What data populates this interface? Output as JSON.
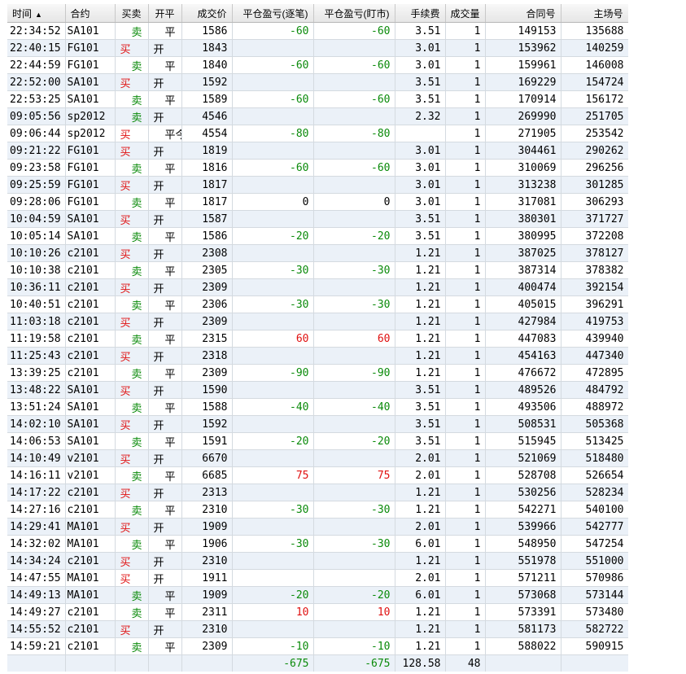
{
  "columns": [
    {
      "label": "时间",
      "sort": "▲"
    },
    {
      "label": "合约"
    },
    {
      "label": "买卖"
    },
    {
      "label": "开平"
    },
    {
      "label": "成交价"
    },
    {
      "label": "平仓盈亏(逐笔)"
    },
    {
      "label": "平仓盈亏(盯市)"
    },
    {
      "label": "手续费"
    },
    {
      "label": "成交量"
    },
    {
      "label": "合同号"
    },
    {
      "label": "主场号"
    }
  ],
  "rows": [
    [
      "22:34:52",
      "SA101",
      "卖",
      "平",
      "1586",
      "-60",
      "-60",
      "3.51",
      "1",
      "149153",
      "135688"
    ],
    [
      "22:40:15",
      "FG101",
      "买",
      "开",
      "1843",
      "",
      "",
      "3.01",
      "1",
      "153962",
      "140259"
    ],
    [
      "22:44:59",
      "FG101",
      "卖",
      "平",
      "1840",
      "-60",
      "-60",
      "3.01",
      "1",
      "159961",
      "146008"
    ],
    [
      "22:52:00",
      "SA101",
      "买",
      "开",
      "1592",
      "",
      "",
      "3.51",
      "1",
      "169229",
      "154724"
    ],
    [
      "22:53:25",
      "SA101",
      "卖",
      "平",
      "1589",
      "-60",
      "-60",
      "3.51",
      "1",
      "170914",
      "156172"
    ],
    [
      "09:05:56",
      "sp2012",
      "卖",
      "开",
      "4546",
      "",
      "",
      "2.32",
      "1",
      "269990",
      "251705"
    ],
    [
      "09:06:44",
      "sp2012",
      "买",
      "平今",
      "4554",
      "-80",
      "-80",
      "",
      "1",
      "271905",
      "253542"
    ],
    [
      "09:21:22",
      "FG101",
      "买",
      "开",
      "1819",
      "",
      "",
      "3.01",
      "1",
      "304461",
      "290262"
    ],
    [
      "09:23:58",
      "FG101",
      "卖",
      "平",
      "1816",
      "-60",
      "-60",
      "3.01",
      "1",
      "310069",
      "296256"
    ],
    [
      "09:25:59",
      "FG101",
      "买",
      "开",
      "1817",
      "",
      "",
      "3.01",
      "1",
      "313238",
      "301285"
    ],
    [
      "09:28:06",
      "FG101",
      "卖",
      "平",
      "1817",
      "0",
      "0",
      "3.01",
      "1",
      "317081",
      "306293"
    ],
    [
      "10:04:59",
      "SA101",
      "买",
      "开",
      "1587",
      "",
      "",
      "3.51",
      "1",
      "380301",
      "371727"
    ],
    [
      "10:05:14",
      "SA101",
      "卖",
      "平",
      "1586",
      "-20",
      "-20",
      "3.51",
      "1",
      "380995",
      "372208"
    ],
    [
      "10:10:26",
      "c2101",
      "买",
      "开",
      "2308",
      "",
      "",
      "1.21",
      "1",
      "387025",
      "378127"
    ],
    [
      "10:10:38",
      "c2101",
      "卖",
      "平",
      "2305",
      "-30",
      "-30",
      "1.21",
      "1",
      "387314",
      "378382"
    ],
    [
      "10:36:11",
      "c2101",
      "买",
      "开",
      "2309",
      "",
      "",
      "1.21",
      "1",
      "400474",
      "392154"
    ],
    [
      "10:40:51",
      "c2101",
      "卖",
      "平",
      "2306",
      "-30",
      "-30",
      "1.21",
      "1",
      "405015",
      "396291"
    ],
    [
      "11:03:18",
      "c2101",
      "买",
      "开",
      "2309",
      "",
      "",
      "1.21",
      "1",
      "427984",
      "419753"
    ],
    [
      "11:19:58",
      "c2101",
      "卖",
      "平",
      "2315",
      "60",
      "60",
      "1.21",
      "1",
      "447083",
      "439940"
    ],
    [
      "11:25:43",
      "c2101",
      "买",
      "开",
      "2318",
      "",
      "",
      "1.21",
      "1",
      "454163",
      "447340"
    ],
    [
      "13:39:25",
      "c2101",
      "卖",
      "平",
      "2309",
      "-90",
      "-90",
      "1.21",
      "1",
      "476672",
      "472895"
    ],
    [
      "13:48:22",
      "SA101",
      "买",
      "开",
      "1590",
      "",
      "",
      "3.51",
      "1",
      "489526",
      "484792"
    ],
    [
      "13:51:24",
      "SA101",
      "卖",
      "平",
      "1588",
      "-40",
      "-40",
      "3.51",
      "1",
      "493506",
      "488972"
    ],
    [
      "14:02:10",
      "SA101",
      "买",
      "开",
      "1592",
      "",
      "",
      "3.51",
      "1",
      "508531",
      "505368"
    ],
    [
      "14:06:53",
      "SA101",
      "卖",
      "平",
      "1591",
      "-20",
      "-20",
      "3.51",
      "1",
      "515945",
      "513425"
    ],
    [
      "14:10:49",
      "v2101",
      "买",
      "开",
      "6670",
      "",
      "",
      "2.01",
      "1",
      "521069",
      "518480"
    ],
    [
      "14:16:11",
      "v2101",
      "卖",
      "平",
      "6685",
      "75",
      "75",
      "2.01",
      "1",
      "528708",
      "526654"
    ],
    [
      "14:17:22",
      "c2101",
      "买",
      "开",
      "2313",
      "",
      "",
      "1.21",
      "1",
      "530256",
      "528234"
    ],
    [
      "14:27:16",
      "c2101",
      "卖",
      "平",
      "2310",
      "-30",
      "-30",
      "1.21",
      "1",
      "542271",
      "540100"
    ],
    [
      "14:29:41",
      "MA101",
      "买",
      "开",
      "1909",
      "",
      "",
      "2.01",
      "1",
      "539966",
      "542777"
    ],
    [
      "14:32:02",
      "MA101",
      "卖",
      "平",
      "1906",
      "-30",
      "-30",
      "6.01",
      "1",
      "548950",
      "547254"
    ],
    [
      "14:34:24",
      "c2101",
      "买",
      "开",
      "2310",
      "",
      "",
      "1.21",
      "1",
      "551978",
      "551000"
    ],
    [
      "14:47:55",
      "MA101",
      "买",
      "开",
      "1911",
      "",
      "",
      "2.01",
      "1",
      "571211",
      "570986"
    ],
    [
      "14:49:13",
      "MA101",
      "卖",
      "平",
      "1909",
      "-20",
      "-20",
      "6.01",
      "1",
      "573068",
      "573144"
    ],
    [
      "14:49:27",
      "c2101",
      "卖",
      "平",
      "2311",
      "10",
      "10",
      "1.21",
      "1",
      "573391",
      "573480"
    ],
    [
      "14:55:52",
      "c2101",
      "买",
      "开",
      "2310",
      "",
      "",
      "1.21",
      "1",
      "581173",
      "582722"
    ],
    [
      "14:59:21",
      "c2101",
      "卖",
      "平",
      "2309",
      "-10",
      "-10",
      "1.21",
      "1",
      "588022",
      "590915"
    ]
  ],
  "totals": {
    "pnl_trade": "-675",
    "pnl_mtm": "-675",
    "fee": "128.58",
    "volume": "48"
  },
  "colors": {
    "buy": "#e01010",
    "sell": "#0a8a0a",
    "profit": "#e01010",
    "loss": "#0a8a0a",
    "alt_row": "#ebf1f8"
  }
}
